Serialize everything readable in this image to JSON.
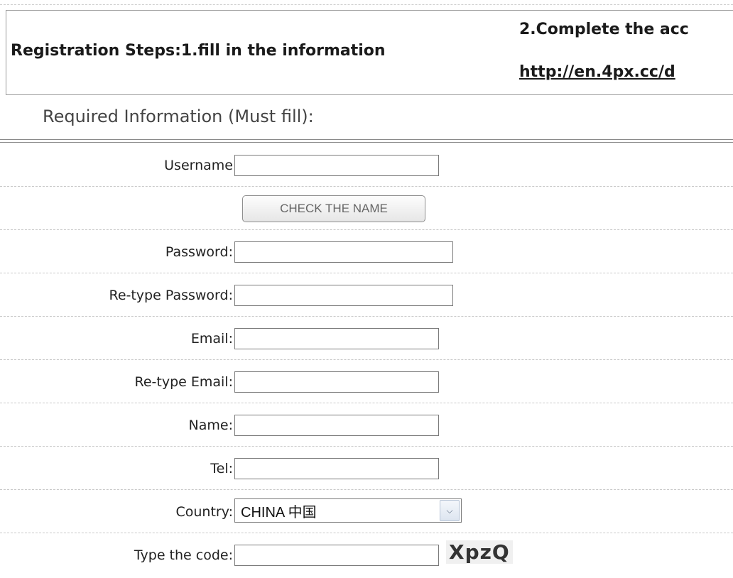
{
  "steps": {
    "step1": "Registration Steps:1.fill in the information",
    "step2": "2.Complete the acc",
    "link": "http://en.4px.cc/d"
  },
  "required_title": "Required Information (Must fill):",
  "form": {
    "username_label": "Username",
    "check_button": "CHECK THE NAME",
    "password_label": "Password:",
    "retype_password_label": "Re-type Password:",
    "email_label": "Email:",
    "retype_email_label": "Re-type Email:",
    "name_label": "Name:",
    "tel_label": "Tel:",
    "country_label": "Country:",
    "country_value": "CHINA 中国",
    "code_label": "Type the code:",
    "captcha": "XpzQ"
  },
  "icons": {
    "select_arrow": "chevron-down-icon"
  }
}
